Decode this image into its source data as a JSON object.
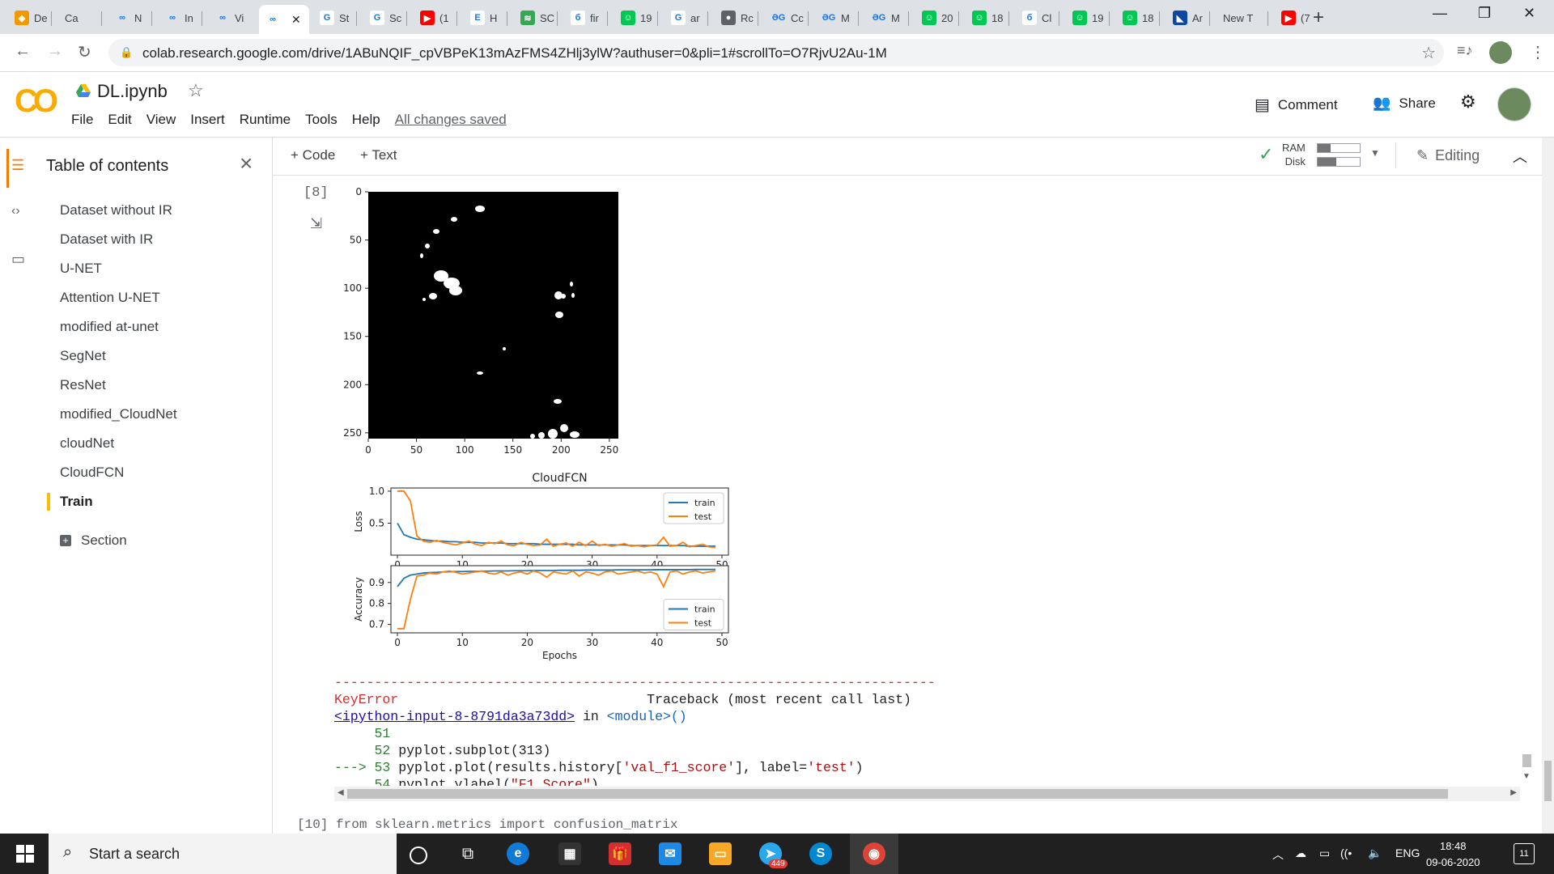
{
  "browser": {
    "tabs": [
      {
        "label": "De",
        "fav": "#f29900",
        "g": "◈"
      },
      {
        "label": "Ca",
        "fav": "#bdbdbd",
        "g": ""
      },
      {
        "label": "N",
        "fav": "#dee1e6",
        "g": "∞"
      },
      {
        "label": "In",
        "fav": "#dee1e6",
        "g": "∞"
      },
      {
        "label": "Vi",
        "fav": "#dee1e6",
        "g": "∞"
      },
      {
        "label": "",
        "fav": "#ffffff",
        "g": "∞"
      },
      {
        "label": "St",
        "fav": "#ffffff",
        "g": "G"
      },
      {
        "label": "Sc",
        "fav": "#ffffff",
        "g": "G"
      },
      {
        "label": "(1",
        "fav": "#ff0000",
        "g": "▶"
      },
      {
        "label": "H",
        "fav": "#ffffff",
        "g": "E"
      },
      {
        "label": "SC",
        "fav": "#34a853",
        "g": "≋"
      },
      {
        "label": "fir",
        "fav": "#ffffff",
        "g": "б"
      },
      {
        "label": "19",
        "fav": "#00c853",
        "g": "☺"
      },
      {
        "label": "ar",
        "fav": "#ffffff",
        "g": "G"
      },
      {
        "label": "Rc",
        "fav": "#5f6368",
        "g": "●"
      },
      {
        "label": "Cc",
        "fav": "#dee1e6",
        "g": "ƏG"
      },
      {
        "label": "M",
        "fav": "#dee1e6",
        "g": "ƏG"
      },
      {
        "label": "M",
        "fav": "#dee1e6",
        "g": "ƏG"
      },
      {
        "label": "20",
        "fav": "#00c853",
        "g": "☺"
      },
      {
        "label": "18",
        "fav": "#00c853",
        "g": "☺"
      },
      {
        "label": "Cl",
        "fav": "#ffffff",
        "g": "б"
      },
      {
        "label": "19",
        "fav": "#00c853",
        "g": "☺"
      },
      {
        "label": "18",
        "fav": "#00c853",
        "g": "☺"
      },
      {
        "label": "Ar",
        "fav": "#0d47a1",
        "g": "◣"
      },
      {
        "label": "New T",
        "fav": "",
        "g": ""
      },
      {
        "label": "(7",
        "fav": "#ff0000",
        "g": "▶"
      }
    ],
    "new_tab": "+",
    "url": "colab.research.google.com/drive/1ABuNQIF_cpVBPeK13mAzFMS4ZHlj3ylW?authuser=0&pli=1#scrollTo=O7RjvU2Au-1M"
  },
  "colab": {
    "logo": "CO",
    "title": "DL.ipynb",
    "menu": [
      "File",
      "Edit",
      "View",
      "Insert",
      "Runtime",
      "Tools",
      "Help"
    ],
    "saved_status": "All changes saved",
    "comment_label": "Comment",
    "share_label": "Share",
    "add_code": "+ Code",
    "add_text": "+ Text",
    "ram_label": "RAM",
    "disk_label": "Disk",
    "ram_fill": 0.3,
    "disk_fill": 0.45,
    "editing_label": "Editing"
  },
  "toc": {
    "heading": "Table of contents",
    "items": [
      "Dataset without IR",
      "Dataset with IR",
      "U-NET",
      "Attention U-NET",
      "modified at-unet",
      "SegNet",
      "ResNet",
      "modified_CloudNet",
      "cloudNet",
      "CloudFCN",
      "Train"
    ],
    "section_label": "Section"
  },
  "cell": {
    "exec_count": "[8]",
    "image_ticks": [
      "0",
      "50",
      "100",
      "150",
      "200",
      "250"
    ]
  },
  "chart_data": [
    {
      "type": "line",
      "title": "CloudFCN",
      "ylabel": "Loss",
      "xlabel": "",
      "xticks": [
        0,
        10,
        20,
        30,
        40,
        50
      ],
      "yticks": [
        0.5,
        1.0
      ],
      "ylim": [
        0.0,
        1.05
      ],
      "xlim": [
        -1,
        51
      ],
      "legend": "top-right",
      "series": [
        {
          "name": "train",
          "color": "#1f77b4",
          "values": [
            0.5,
            0.32,
            0.28,
            0.25,
            0.24,
            0.23,
            0.22,
            0.22,
            0.21,
            0.21,
            0.2,
            0.2,
            0.2,
            0.19,
            0.19,
            0.19,
            0.19,
            0.18,
            0.18,
            0.18,
            0.18,
            0.18,
            0.17,
            0.17,
            0.17,
            0.17,
            0.17,
            0.17,
            0.16,
            0.16,
            0.16,
            0.16,
            0.16,
            0.16,
            0.16,
            0.16,
            0.15,
            0.15,
            0.15,
            0.15,
            0.15,
            0.15,
            0.15,
            0.15,
            0.15,
            0.14,
            0.14,
            0.14,
            0.14,
            0.14
          ]
        },
        {
          "name": "test",
          "color": "#ff7f0e",
          "values": [
            1.0,
            1.0,
            0.85,
            0.3,
            0.22,
            0.2,
            0.23,
            0.2,
            0.18,
            0.16,
            0.19,
            0.22,
            0.17,
            0.15,
            0.2,
            0.18,
            0.22,
            0.16,
            0.15,
            0.2,
            0.17,
            0.15,
            0.16,
            0.25,
            0.14,
            0.17,
            0.19,
            0.14,
            0.2,
            0.15,
            0.22,
            0.15,
            0.17,
            0.14,
            0.16,
            0.18,
            0.14,
            0.15,
            0.13,
            0.15,
            0.16,
            0.28,
            0.14,
            0.15,
            0.2,
            0.13,
            0.15,
            0.17,
            0.13,
            0.12
          ]
        }
      ]
    },
    {
      "type": "line",
      "title": "",
      "ylabel": "Accuracy",
      "xlabel": "Epochs",
      "xticks": [
        0,
        10,
        20,
        30,
        40,
        50
      ],
      "yticks": [
        0.7,
        0.8,
        0.9
      ],
      "ylim": [
        0.66,
        0.98
      ],
      "xlim": [
        -1,
        51
      ],
      "legend": "center-right",
      "series": [
        {
          "name": "train",
          "color": "#1f77b4",
          "values": [
            0.88,
            0.92,
            0.935,
            0.94,
            0.945,
            0.947,
            0.948,
            0.95,
            0.951,
            0.952,
            0.952,
            0.953,
            0.953,
            0.954,
            0.954,
            0.955,
            0.955,
            0.955,
            0.956,
            0.956,
            0.956,
            0.957,
            0.957,
            0.957,
            0.957,
            0.958,
            0.958,
            0.958,
            0.958,
            0.959,
            0.959,
            0.959,
            0.959,
            0.959,
            0.96,
            0.96,
            0.96,
            0.96,
            0.96,
            0.96,
            0.961,
            0.961,
            0.961,
            0.961,
            0.961,
            0.961,
            0.962,
            0.962,
            0.962,
            0.962
          ]
        },
        {
          "name": "test",
          "color": "#ff7f0e",
          "values": [
            0.68,
            0.68,
            0.82,
            0.93,
            0.935,
            0.945,
            0.94,
            0.95,
            0.955,
            0.948,
            0.94,
            0.945,
            0.95,
            0.955,
            0.945,
            0.94,
            0.95,
            0.935,
            0.945,
            0.95,
            0.94,
            0.955,
            0.945,
            0.925,
            0.95,
            0.945,
            0.94,
            0.955,
            0.93,
            0.95,
            0.945,
            0.935,
            0.95,
            0.955,
            0.94,
            0.945,
            0.95,
            0.955,
            0.945,
            0.95,
            0.94,
            0.88,
            0.95,
            0.955,
            0.94,
            0.95,
            0.955,
            0.945,
            0.95,
            0.955
          ]
        }
      ]
    }
  ],
  "traceback": {
    "dashes": "---------------------------------------------------------------------------",
    "error_name": "KeyError",
    "header_right": "Traceback (most recent call last)",
    "input_link": "<ipython-input-8-8791da3a73dd>",
    "in_text": " in ",
    "module": "<module>()",
    "line51": "     51",
    "line52_no": "     52 ",
    "line52_code": "pyplot.subplot(313)",
    "arrow": "---> 53 ",
    "line53_a": "pyplot.plot(results.history[",
    "line53_key": "'val_f1_score'",
    "line53_b": "], label=",
    "line53_label": "'test'",
    "line53_c": ")",
    "line54_no": "     54 ",
    "line54_a": "pyplot.ylabel(",
    "line54_str": "\"F1 Score\"",
    "line54_c": ")"
  },
  "next_cell": "[10]  from sklearn.metrics import confusion_matrix",
  "taskbar": {
    "search_placeholder": "Start a search",
    "telegram_badge": "449",
    "lang": "ENG",
    "time": "18:48",
    "date": "09-06-2020",
    "notif_count": "11"
  }
}
